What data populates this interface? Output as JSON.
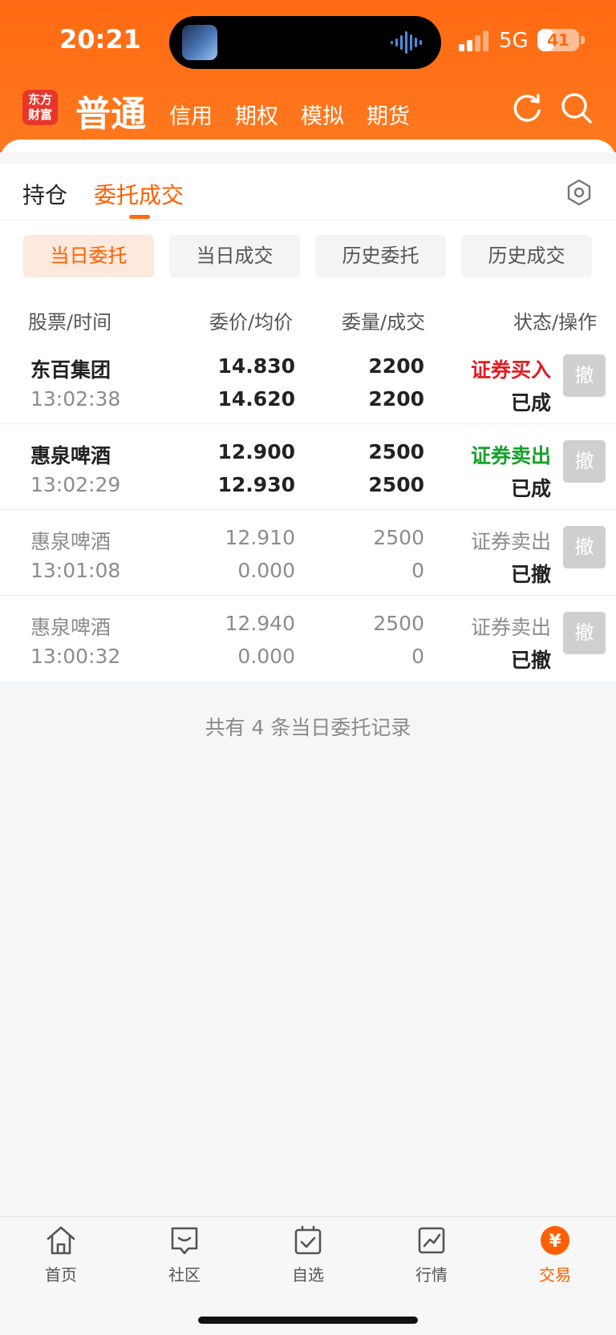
{
  "status_bar": {
    "time": "20:21",
    "network": "5G",
    "battery": "41",
    "battery_level": 0.41
  },
  "header": {
    "logo_line1": "东方",
    "logo_line2": "财富",
    "active_tab": "普通",
    "tabs": [
      "信用",
      "期权",
      "模拟",
      "期货"
    ],
    "icons": [
      "refresh-icon",
      "search-icon"
    ]
  },
  "main_tabs": {
    "positions": "持仓",
    "orders": "委托成交"
  },
  "segments": [
    "当日委托",
    "当日成交",
    "历史委托",
    "历史成交"
  ],
  "columns": {
    "stock_time": "股票/时间",
    "price": "委价/均价",
    "qty": "委量/成交",
    "status": "状态/操作"
  },
  "orders": [
    {
      "name": "东百集团",
      "time": "13:02:38",
      "order_price": "14.830",
      "avg_price": "14.620",
      "order_qty": "2200",
      "filled_qty": "2200",
      "side": "证券买入",
      "status": "已成",
      "cancel": "撤"
    },
    {
      "name": "惠泉啤酒",
      "time": "13:02:29",
      "order_price": "12.900",
      "avg_price": "12.930",
      "order_qty": "2500",
      "filled_qty": "2500",
      "side": "证券卖出",
      "status": "已成",
      "cancel": "撤"
    },
    {
      "name": "惠泉啤酒",
      "time": "13:01:08",
      "order_price": "12.910",
      "avg_price": "0.000",
      "order_qty": "2500",
      "filled_qty": "0",
      "side": "证券卖出",
      "status": "已撤",
      "cancel": "撤"
    },
    {
      "name": "惠泉啤酒",
      "time": "13:00:32",
      "order_price": "12.940",
      "avg_price": "0.000",
      "order_qty": "2500",
      "filled_qty": "0",
      "side": "证券卖出",
      "status": "已撤",
      "cancel": "撤"
    }
  ],
  "summary": "共有 4 条当日委托记录",
  "bottom_nav": [
    {
      "label": "首页",
      "icon": "home-icon"
    },
    {
      "label": "社区",
      "icon": "community-icon"
    },
    {
      "label": "自选",
      "icon": "watchlist-icon"
    },
    {
      "label": "行情",
      "icon": "market-icon"
    },
    {
      "label": "交易",
      "icon": "trade-icon"
    }
  ],
  "colors": {
    "brand": "#ff6a12",
    "buy": "#e31b23",
    "sell": "#17a12c",
    "active_segment_text": "#ff5f00"
  }
}
